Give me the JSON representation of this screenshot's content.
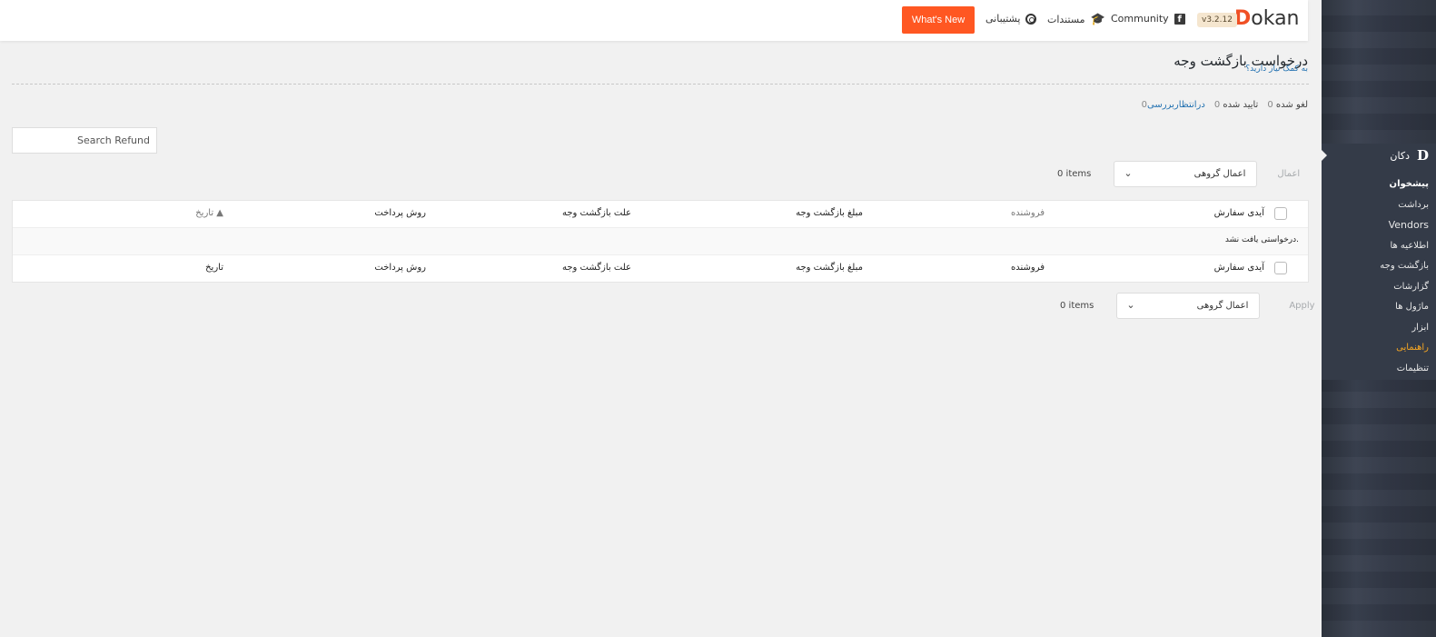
{
  "header": {
    "logo_d": "D",
    "logo_rest": "okan",
    "version": "v3.2.12",
    "community_label": "Community",
    "docs_label": "مستندات",
    "support_label": "پشتیبانی",
    "whats_new_label": "What's New"
  },
  "page": {
    "title": "درخواست بازگشت وجه",
    "help_link": "به کمک نیاز دارید؟"
  },
  "filters": [
    {
      "label": "درانتظاربررسی",
      "count": "0"
    },
    {
      "label": "تایید شده",
      "count": "0"
    },
    {
      "label": "لغو شده",
      "count": "0"
    }
  ],
  "search": {
    "placeholder": "Search Refund"
  },
  "top_bulk": {
    "select_label": "اعمال گروهی",
    "apply_label": "اعمال",
    "items": "0 items"
  },
  "bottom_bulk": {
    "select_label": "اعمال گروهی",
    "apply_label": "Apply",
    "items": "0 items"
  },
  "table": {
    "columns": {
      "order_id": "آیدی سفارش",
      "vendor": "فروشنده",
      "amount": "مبلغ بازگشت وجه",
      "reason": "علت بازگشت وجه",
      "method": "روش پرداخت",
      "date": "تاریخ"
    },
    "sort_indicator": "▲",
    "empty_message": "درخواستی یافت نشد."
  },
  "sidebar": {
    "brand": "دکان",
    "items": [
      {
        "label": "پیشخوان",
        "state": "active"
      },
      {
        "label": "برداشت",
        "state": ""
      },
      {
        "label": "Vendors",
        "state": "vendor"
      },
      {
        "label": "اطلاعیه ها",
        "state": ""
      },
      {
        "label": "بازگشت وجه",
        "state": ""
      },
      {
        "label": "گزارشات",
        "state": ""
      },
      {
        "label": "ماژول ها",
        "state": ""
      },
      {
        "label": "ابزار",
        "state": ""
      },
      {
        "label": "راهنمایی",
        "state": "orange"
      },
      {
        "label": "تنظیمات",
        "state": ""
      }
    ]
  },
  "colors": {
    "accent": "#ff5722",
    "link": "#2271b1",
    "sidebar": "#343b48",
    "highlight": "#f5a623"
  }
}
